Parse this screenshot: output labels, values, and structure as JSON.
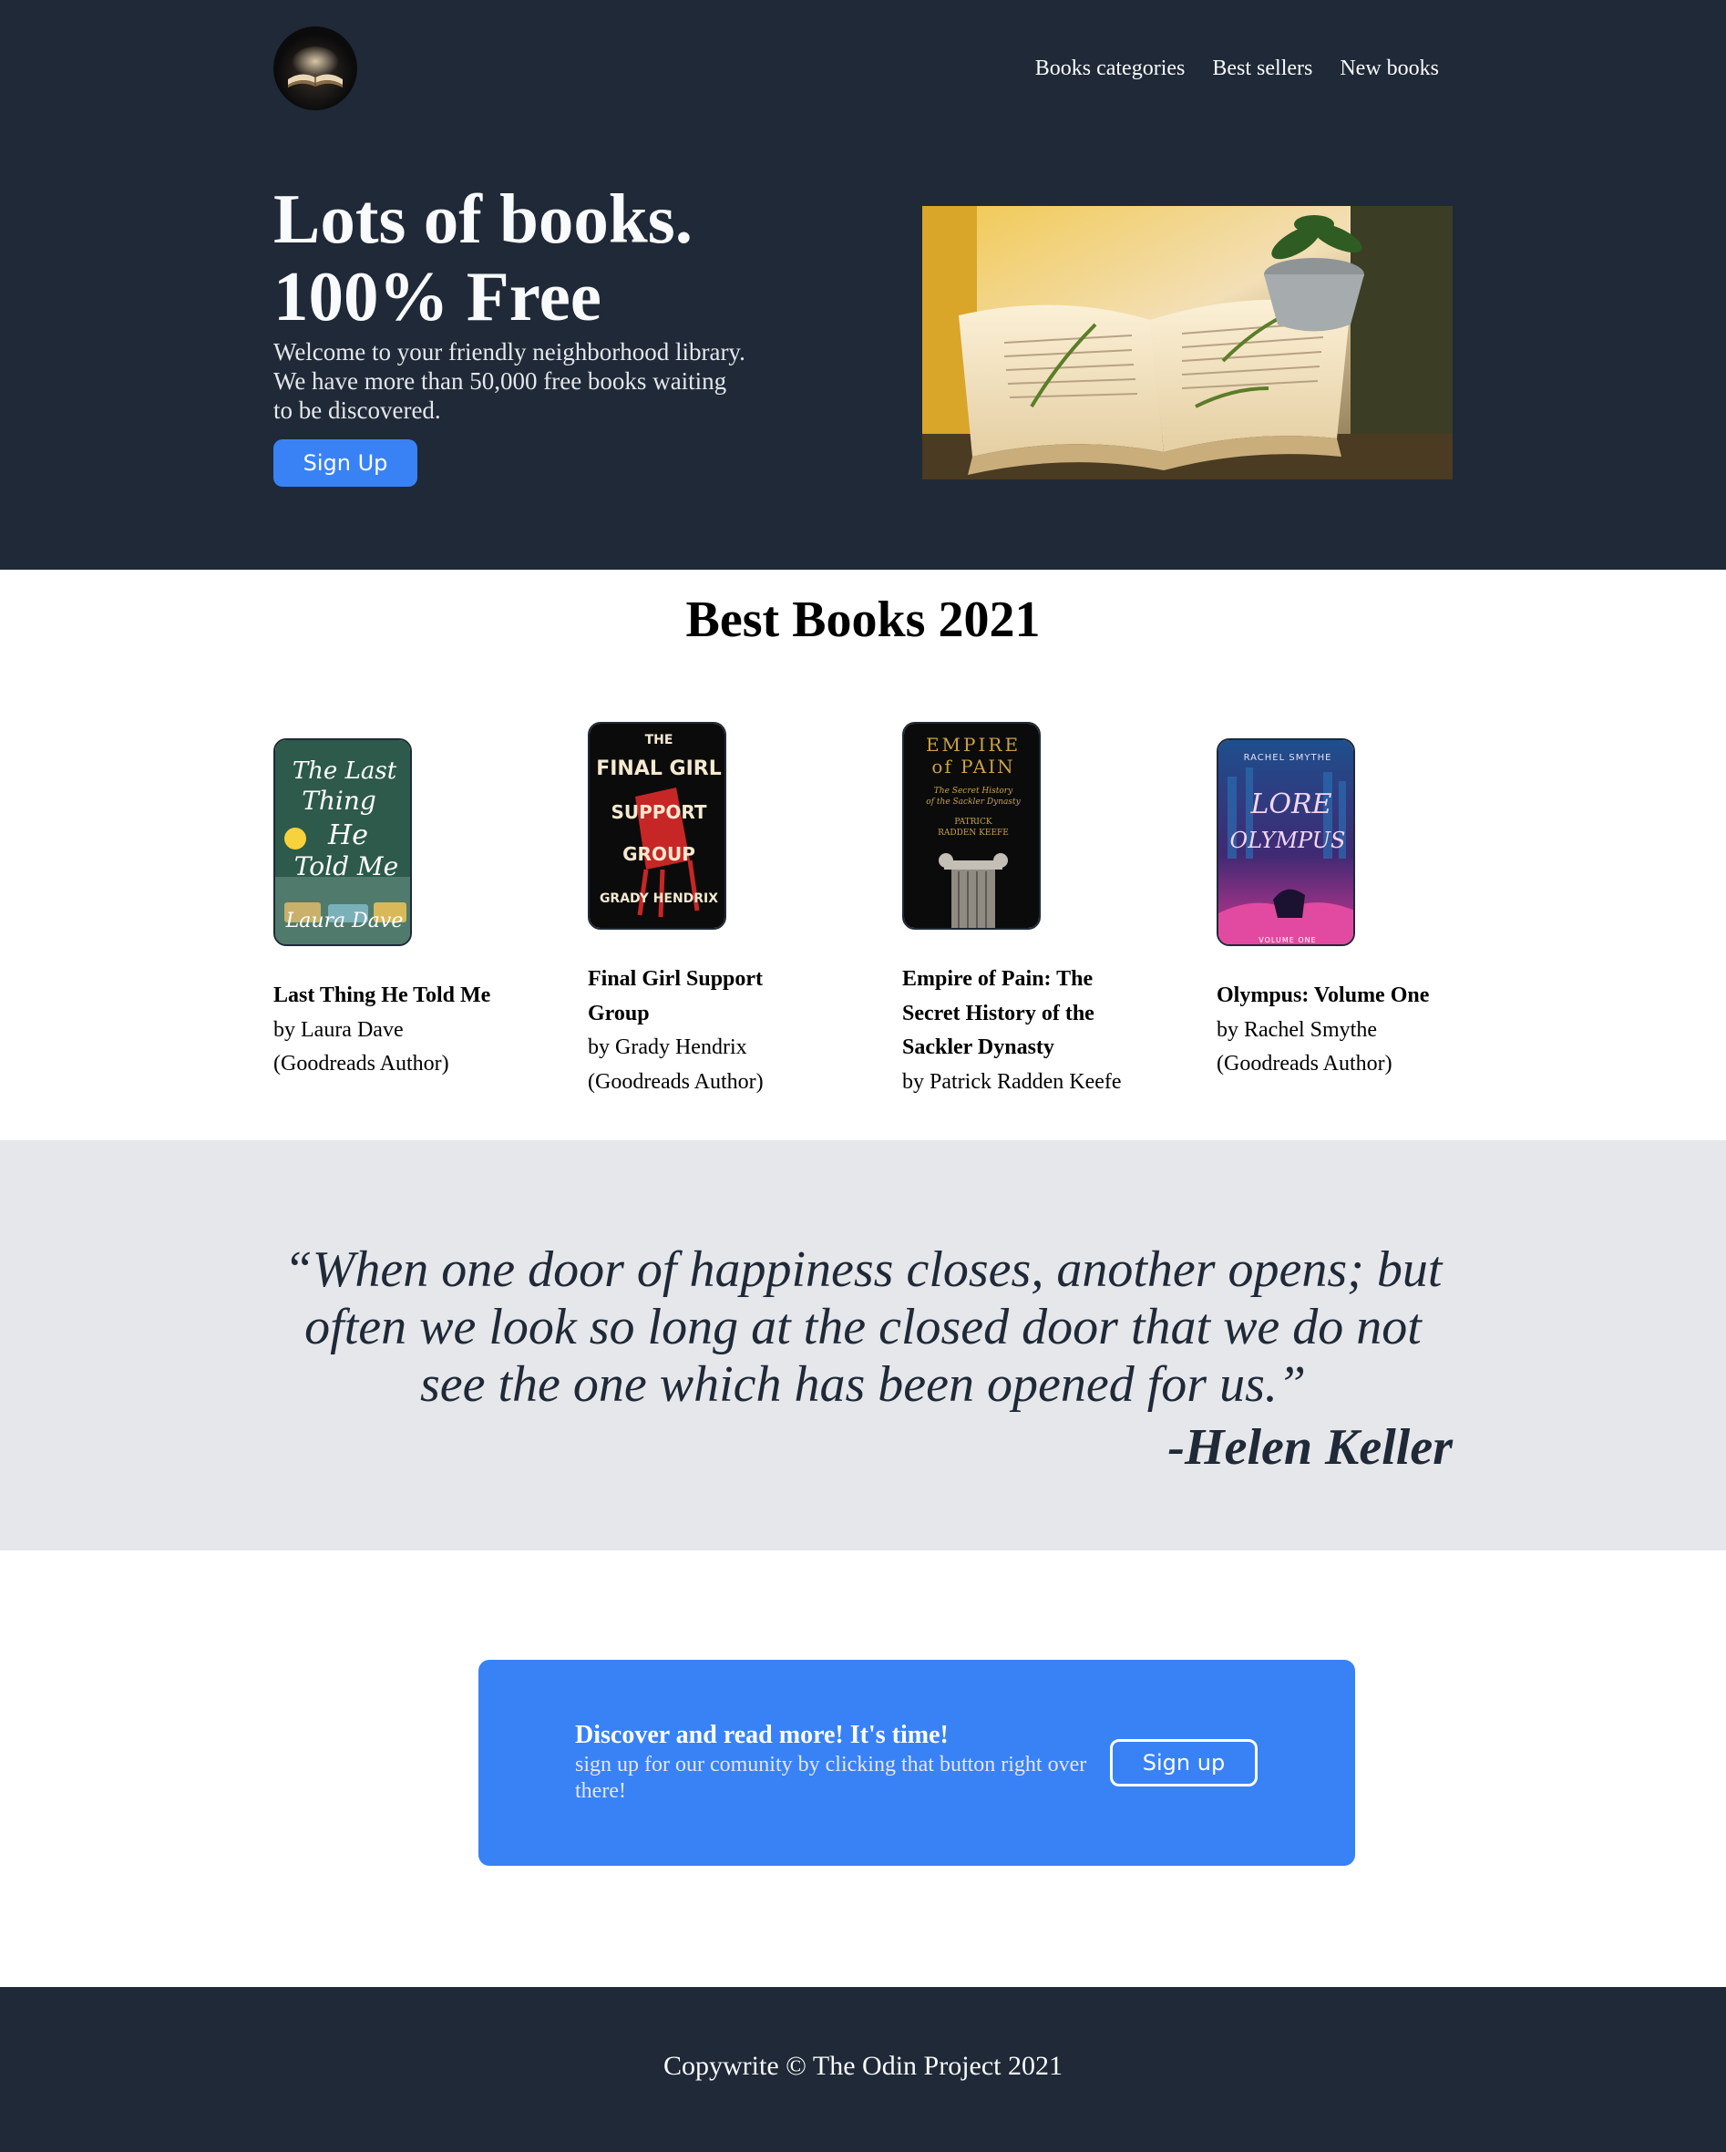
{
  "header": {
    "logo_alt": "open book logo",
    "nav": [
      "Books categories",
      "Best sellers",
      "New books"
    ]
  },
  "hero": {
    "title_line1": "Lots of books.",
    "title_line2": "100% Free",
    "text": "Welcome to your friendly neighborhood library. We have more than 50,000 free books waiting to be discovered.",
    "button": "Sign Up"
  },
  "best_books": {
    "title": "Best Books 2021",
    "books": [
      {
        "title": "Last Thing He Told Me",
        "author": "by Laura Dave",
        "note": "(Goodreads Author)",
        "cover_lines": [
          "The Last",
          "Thing",
          "He",
          "Told Me",
          "Laura Dave"
        ]
      },
      {
        "title": "Final Girl Support Group",
        "author": "by Grady Hendrix",
        "note": "(Goodreads Author)",
        "cover_lines": [
          "THE",
          "FINAL GIRL",
          "SUPPORT",
          "GROUP",
          "GRADY HENDRIX"
        ]
      },
      {
        "title": "Empire of Pain: The Secret History of the Sackler Dynasty",
        "author": "by Patrick Radden Keefe",
        "note": "",
        "cover_lines": [
          "EMPIRE",
          "of PAIN",
          "The Secret History",
          "of the Sackler Dynasty",
          "PATRICK",
          "RADDEN KEEFE"
        ]
      },
      {
        "title": "Olympus: Volume One",
        "author": "by Rachel Smythe",
        "note": "(Goodreads Author)",
        "cover_lines": [
          "RACHEL SMYTHE",
          "LORE",
          "OLYMPUS",
          "VOLUME ONE"
        ]
      }
    ]
  },
  "quote": {
    "text": "“When one door of happiness closes, another opens; but often we look so long at the closed door that we do not see the one which has been opened for us.”",
    "author": "-Helen Keller"
  },
  "cta": {
    "heading": "Discover and read more! It's time!",
    "subtext": "sign up for our comunity by clicking that button right over there!",
    "button": "Sign up"
  },
  "footer": {
    "text": "Copywrite © The Odin Project 2021"
  },
  "colors": {
    "dark": "#1f2937",
    "accent": "#3882f6",
    "light_gray": "#e5e7eb"
  }
}
